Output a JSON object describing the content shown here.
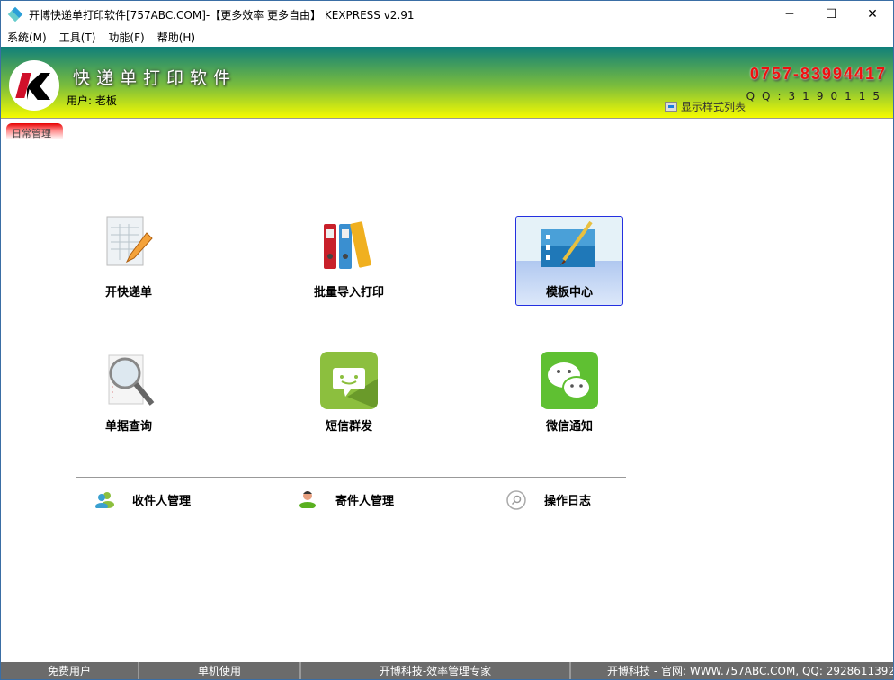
{
  "window": {
    "title": "开博快递单打印软件[757ABC.COM]-【更多效率 更多自由】  KEXPRESS v2.91",
    "minimize": "─",
    "maximize": "☐",
    "close": "✕"
  },
  "menu": [
    "系统(M)",
    "工具(T)",
    "功能(F)",
    "帮助(H)"
  ],
  "header": {
    "app_title": "快递单打印软件",
    "user": "用户: 老板",
    "phone": "0757-83994417",
    "qq": "QQ:3190115",
    "list_toggle": "显示样式列表"
  },
  "tabs": [
    {
      "label": "日常管理",
      "active": true
    }
  ],
  "tiles": [
    {
      "label": "开快递单",
      "icon": "form-edit-icon"
    },
    {
      "label": "批量导入打印",
      "icon": "binders-icon"
    },
    {
      "label": "模板中心",
      "icon": "template-icon",
      "selected": true
    },
    {
      "label": "单据查询",
      "icon": "magnifier-icon"
    },
    {
      "label": "短信群发",
      "icon": "sms-icon"
    },
    {
      "label": "微信通知",
      "icon": "wechat-icon"
    }
  ],
  "links": [
    {
      "label": "收件人管理",
      "icon": "users-icon"
    },
    {
      "label": "寄件人管理",
      "icon": "user-icon"
    },
    {
      "label": "操作日志",
      "icon": "log-search-icon"
    }
  ],
  "status": [
    "免费用户",
    "单机使用",
    "开博科技-效率管理专家",
    "开博科技 - 官网: WWW.757ABC.COM, QQ: 2928611392"
  ]
}
